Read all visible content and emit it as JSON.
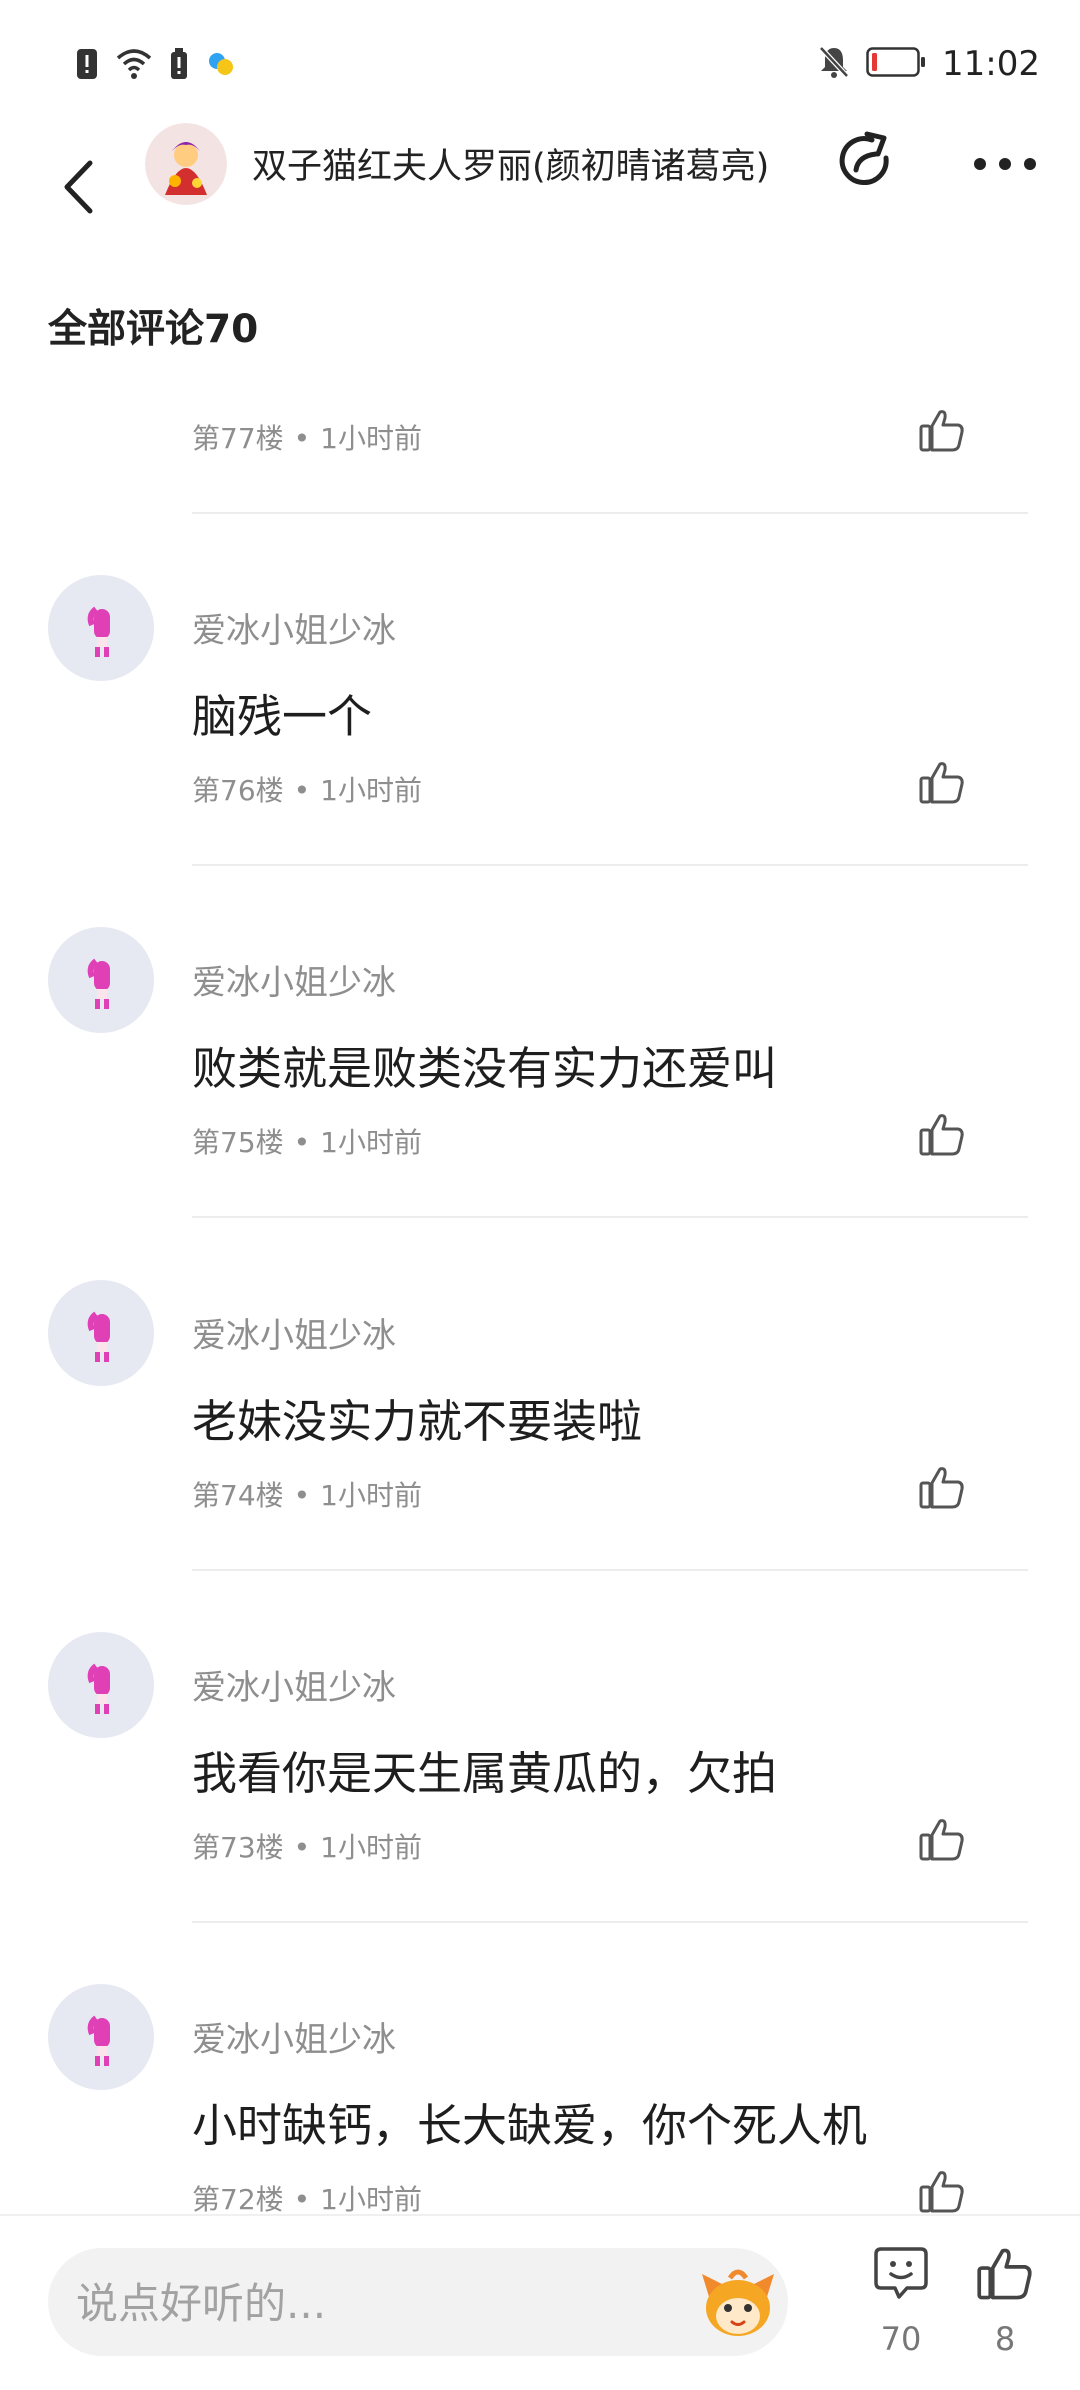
{
  "status_bar": {
    "time": "11:02",
    "icons": [
      "alert-icon",
      "wifi-icon",
      "sim-icon",
      "app-notification-icon",
      "mute-bell-icon",
      "battery-low-icon"
    ]
  },
  "header": {
    "title": "双子猫红夫人罗丽(颜初晴诸葛亮)",
    "back_icon": "chevron-left-icon",
    "share_icon": "share-icon",
    "more_icon": "more-dots-icon"
  },
  "section": {
    "title": "全部评论70"
  },
  "comments": [
    {
      "floor": "第77楼",
      "time": "1小时前"
    },
    {
      "author": "爱冰小姐少冰",
      "text": "脑残一个",
      "floor": "第76楼",
      "time": "1小时前"
    },
    {
      "author": "爱冰小姐少冰",
      "text": "败类就是败类没有实力还爱叫",
      "floor": "第75楼",
      "time": "1小时前"
    },
    {
      "author": "爱冰小姐少冰",
      "text": "老妹没实力就不要装啦",
      "floor": "第74楼",
      "time": "1小时前"
    },
    {
      "author": "爱冰小姐少冰",
      "text": "我看你是天生属黄瓜的，欠拍",
      "floor": "第73楼",
      "time": "1小时前"
    },
    {
      "author": "爱冰小姐少冰",
      "text": "小时缺钙，长大缺爱，你个死人机",
      "floor": "第72楼",
      "time": "1小时前"
    }
  ],
  "bottom_bar": {
    "input_placeholder": "说点好听的...",
    "comment_count": "70",
    "like_count": "8"
  },
  "colors": {
    "text_primary": "#1e1e1e",
    "text_secondary": "#8e8e8e",
    "avatar_bg": "#e6e9f2",
    "divider": "#ececec",
    "input_bg": "#f2f2f2"
  }
}
